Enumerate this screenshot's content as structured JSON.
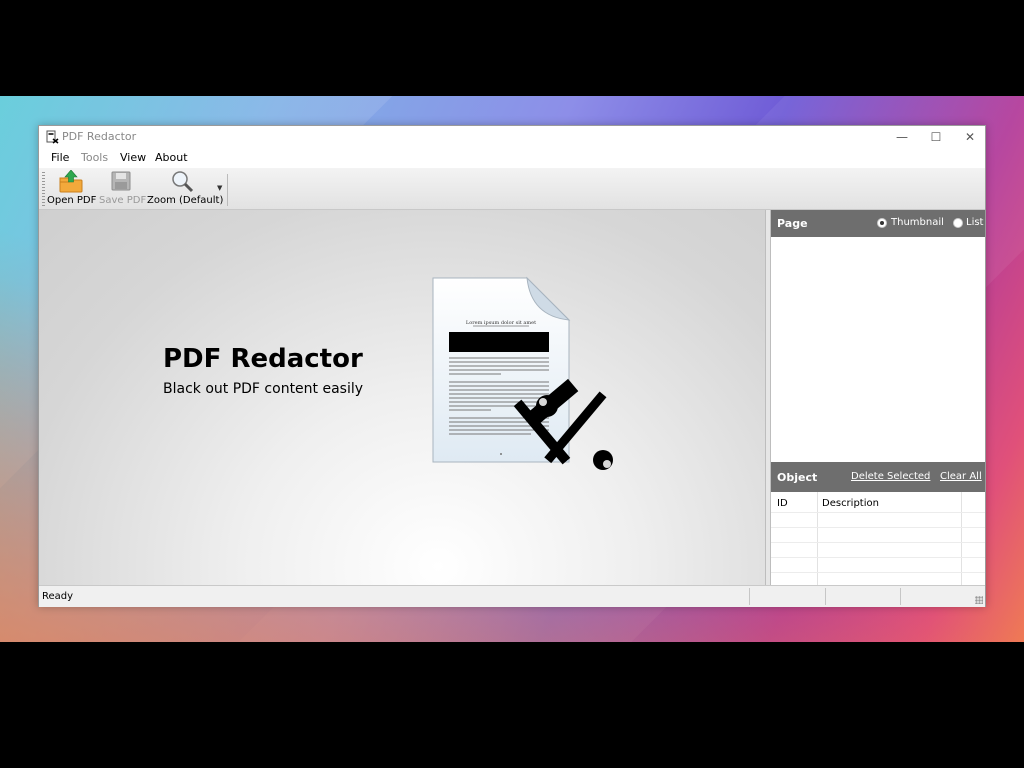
{
  "window": {
    "title": "PDF Redactor"
  },
  "menu": {
    "file": "File",
    "tools": "Tools",
    "view": "View",
    "about": "About"
  },
  "toolbar": {
    "open_pdf": "Open PDF",
    "save_pdf": "Save PDF",
    "zoom": "Zoom (Default)"
  },
  "splash": {
    "title": "PDF Redactor",
    "subtitle": "Black out PDF content easily",
    "doc_heading": "Lorem ipsum dolor sit amet"
  },
  "page_panel": {
    "title": "Page",
    "thumbnail_label": "Thumbnail",
    "list_label": "List",
    "selected_view": "Thumbnail"
  },
  "object_panel": {
    "title": "Object",
    "delete_selected": "Delete Selected",
    "clear_all": "Clear All",
    "columns": [
      "ID",
      "Description"
    ]
  },
  "status": {
    "text": "Ready"
  },
  "colors": {
    "panel_header": "#6e6e6e",
    "open_icon_green": "#2fa84f",
    "folder_orange": "#f2a93b"
  }
}
